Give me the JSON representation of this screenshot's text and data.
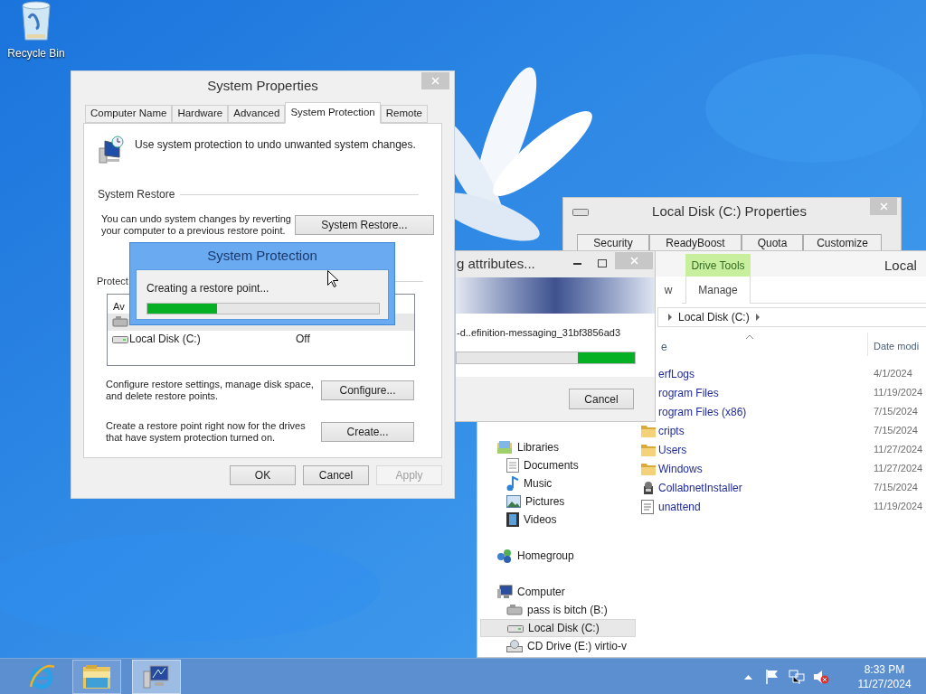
{
  "desktop": {
    "icons": [
      {
        "label": "Recycle Bin",
        "kind": "recycle-bin"
      }
    ]
  },
  "local_disk_properties": {
    "title": "Local Disk (C:) Properties",
    "tabs": [
      {
        "label": "Security",
        "selected": false
      },
      {
        "label": "ReadyBoost",
        "selected": false
      },
      {
        "label": "Quota",
        "selected": false
      },
      {
        "label": "Customize",
        "selected": false
      }
    ]
  },
  "explorer": {
    "title": "Local",
    "context_tab": "Drive Tools",
    "ribbon_tabs": [
      {
        "label": "w",
        "selected": false
      },
      {
        "label": "Manage",
        "selected": false
      }
    ],
    "breadcrumb": [
      "Local Disk (C:)"
    ],
    "columns": [
      "e",
      "Date modi"
    ],
    "files": [
      {
        "name": "erfLogs",
        "date": "4/1/2024"
      },
      {
        "name": "rogram Files",
        "date": "11/19/2024"
      },
      {
        "name": "rogram Files (x86)",
        "date": "7/15/2024"
      },
      {
        "name": "cripts",
        "date": "7/15/2024",
        "kind": "folder"
      },
      {
        "name": "Users",
        "date": "11/27/2024",
        "kind": "folder"
      },
      {
        "name": "Windows",
        "date": "11/27/2024",
        "kind": "folder"
      },
      {
        "name": "CollabnetInstaller",
        "date": "7/15/2024",
        "kind": "app"
      },
      {
        "name": "unattend",
        "date": "11/19/2024",
        "kind": "text"
      }
    ],
    "nav": [
      {
        "label": "Libraries",
        "kind": "library",
        "selected": false,
        "children": [
          {
            "label": "Documents",
            "kind": "documents",
            "selected": false
          },
          {
            "label": "Music",
            "kind": "music",
            "selected": false
          },
          {
            "label": "Pictures",
            "kind": "pictures",
            "selected": false
          },
          {
            "label": "Videos",
            "kind": "videos",
            "selected": false
          }
        ]
      },
      {
        "label": "Homegroup",
        "kind": "homegroup",
        "selected": false
      },
      {
        "label": "Computer",
        "kind": "computer",
        "selected": false,
        "children": [
          {
            "label": "pass is bitch (B:)",
            "kind": "usb-drive",
            "selected": false
          },
          {
            "label": "Local Disk (C:)",
            "kind": "drive",
            "selected": true
          },
          {
            "label": "CD Drive (E:) virtio-v",
            "kind": "cd-drive",
            "selected": false
          }
        ]
      }
    ]
  },
  "copy_dialog": {
    "title": "g attributes...",
    "file": "-d..efinition-messaging_31bf3856ad3",
    "level": 0.32,
    "buttons": [
      "Cancel"
    ]
  },
  "system_properties": {
    "title": "System Properties",
    "tabs": [
      {
        "label": "Computer Name",
        "selected": false
      },
      {
        "label": "Hardware",
        "selected": false
      },
      {
        "label": "Advanced",
        "selected": false
      },
      {
        "label": "System Protection",
        "selected": true
      },
      {
        "label": "Remote",
        "selected": false
      }
    ],
    "intro": "Use system protection to undo unwanted system changes.",
    "restore_heading": "System Restore",
    "restore_text": "You can undo system changes by reverting your computer to a previous restore point.",
    "restore_button": "System Restore...",
    "protection_heading": "Protect",
    "drives_header": "Av",
    "drives": [
      {
        "kind": "usb-drive",
        "selected": true
      },
      {
        "name": "Local Disk (C:)",
        "status": "Off",
        "kind": "drive",
        "selected": false
      }
    ],
    "configure_text": "Configure restore settings, manage disk space, and delete restore points.",
    "configure_button": "Configure...",
    "create_text": "Create a restore point right now for the drives that have system protection turned on.",
    "create_button": "Create...",
    "buttons": [
      {
        "label": "OK",
        "disabled": false
      },
      {
        "label": "Cancel",
        "disabled": false
      },
      {
        "label": "Apply",
        "disabled": true
      }
    ]
  },
  "system_protection": {
    "title": "System Protection",
    "message": "Creating a restore point...",
    "level": 0.3
  },
  "taskbar": {
    "apps": [
      {
        "kind": "ie",
        "selected": false
      },
      {
        "kind": "explorer",
        "selected": false
      },
      {
        "kind": "system",
        "selected": true
      }
    ],
    "tray": [
      {
        "kind": "caret"
      },
      {
        "kind": "flag"
      },
      {
        "kind": "network"
      },
      {
        "kind": "speaker-muted"
      }
    ],
    "time": "8:33 PM",
    "date": "11/27/2024"
  }
}
